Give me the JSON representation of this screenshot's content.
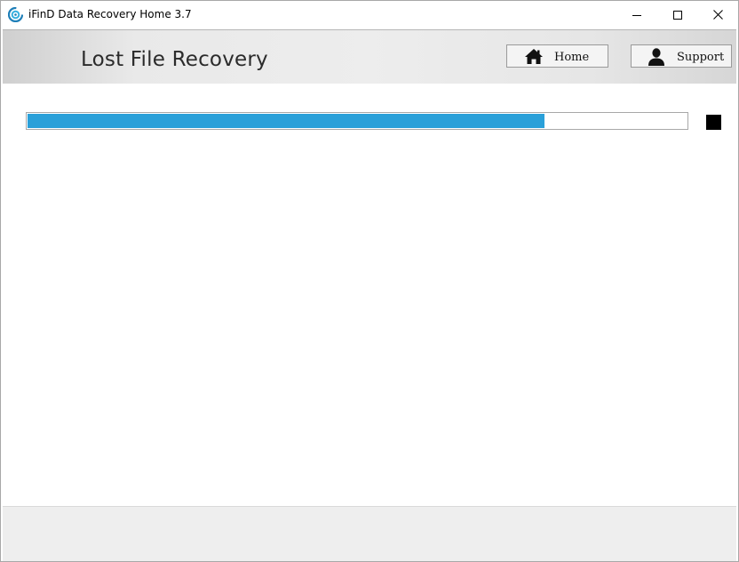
{
  "window": {
    "title": "iFinD Data Recovery Home 3.7",
    "app_icon": "ifind-logo-icon",
    "controls": {
      "minimize_icon": "minimize-icon",
      "maximize_icon": "maximize-icon",
      "close_icon": "close-icon"
    }
  },
  "header": {
    "page_title": "Lost File Recovery",
    "home_button": {
      "label": "Home",
      "icon": "home-icon"
    },
    "support_button": {
      "label": "Support",
      "icon": "user-icon"
    }
  },
  "scan": {
    "progress_percent": 78.5,
    "progress_color": "#2aa0d9",
    "stop_icon": "stop-icon"
  }
}
